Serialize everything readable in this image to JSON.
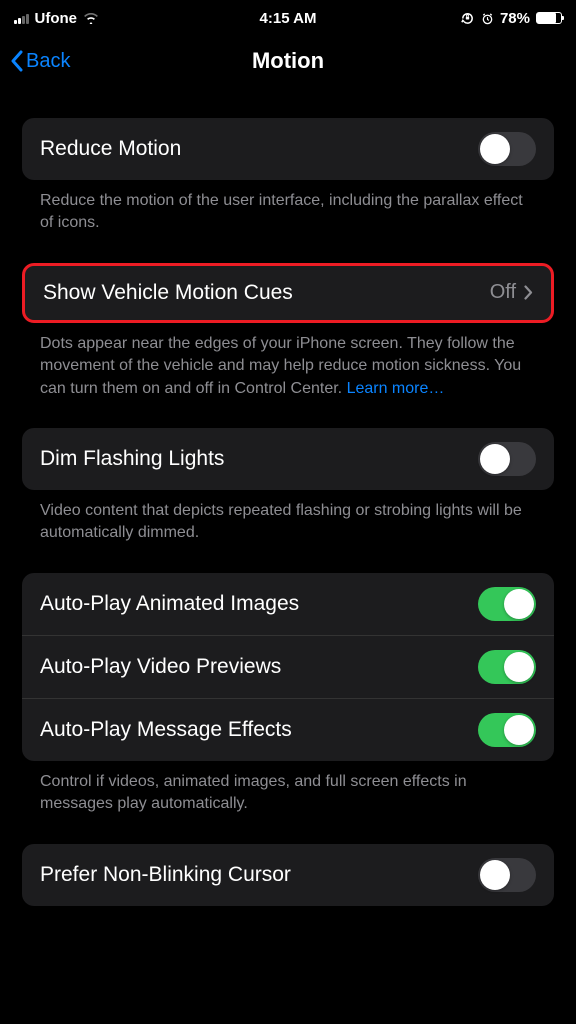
{
  "status_bar": {
    "carrier": "Ufone",
    "time": "4:15 AM",
    "battery_pct": "78%"
  },
  "nav": {
    "back_label": "Back",
    "title": "Motion"
  },
  "groups": {
    "reduce_motion": {
      "label": "Reduce Motion",
      "footer": "Reduce the motion of the user interface, including the parallax effect of icons."
    },
    "vehicle_cues": {
      "label": "Show Vehicle Motion Cues",
      "value": "Off",
      "footer_pre": "Dots appear near the edges of your iPhone screen. They follow the movement of the vehicle and may help reduce motion sickness. You can turn them on and off in Control Center. ",
      "learn_more": "Learn more…"
    },
    "dim": {
      "label": "Dim Flashing Lights",
      "footer": "Video content that depicts repeated flashing or strobing lights will be automatically dimmed."
    },
    "autoplay": {
      "row1": "Auto-Play Animated Images",
      "row2": "Auto-Play Video Previews",
      "row3": "Auto-Play Message Effects",
      "footer": "Control if videos, animated images, and full screen effects in messages play automatically."
    },
    "cursor": {
      "label": "Prefer Non-Blinking Cursor"
    }
  }
}
